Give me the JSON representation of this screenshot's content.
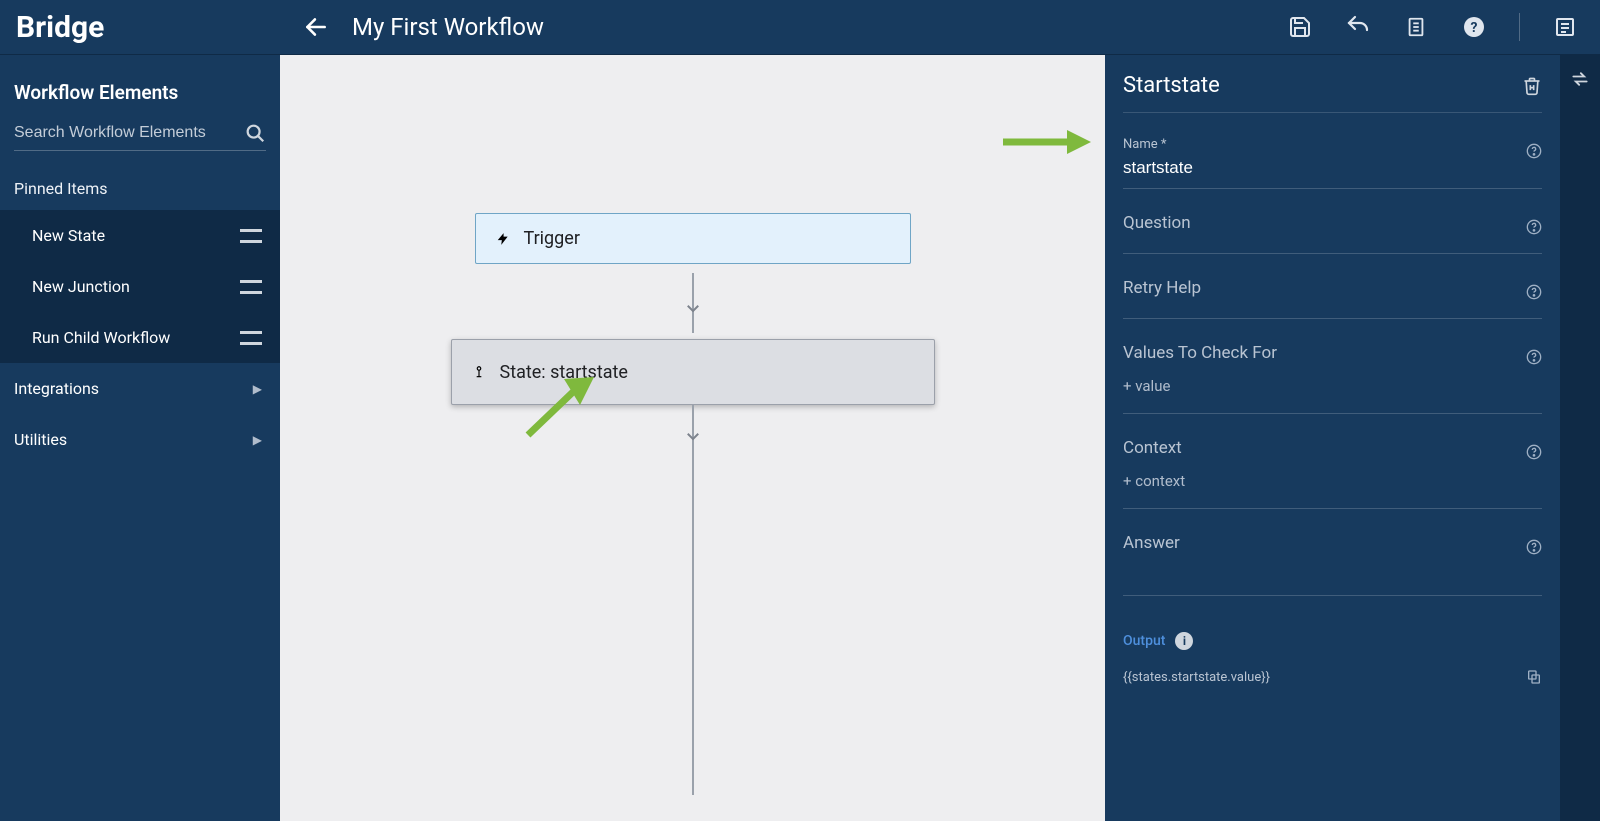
{
  "app": {
    "logo": "Bridge",
    "title": "My First Workflow"
  },
  "sidebar": {
    "heading": "Workflow Elements",
    "searchPlaceholder": "Search Workflow Elements",
    "pinnedHeading": "Pinned Items",
    "pinned": [
      {
        "label": "New State"
      },
      {
        "label": "New Junction"
      },
      {
        "label": "Run Child Workflow"
      }
    ],
    "nav": [
      {
        "label": "Integrations"
      },
      {
        "label": "Utilities"
      }
    ]
  },
  "canvas": {
    "triggerLabel": "Trigger",
    "stateLabel": "State: startstate"
  },
  "panel": {
    "title": "Startstate",
    "nameLabel": "Name *",
    "nameValue": "startstate",
    "questionLabel": "Question",
    "retryLabel": "Retry Help",
    "valuesLabel": "Values To Check For",
    "addValue": "+ value",
    "contextLabel": "Context",
    "addContext": "+ context",
    "answerLabel": "Answer",
    "outputLabel": "Output",
    "outputExpr": "{{states.startstate.value}}"
  }
}
